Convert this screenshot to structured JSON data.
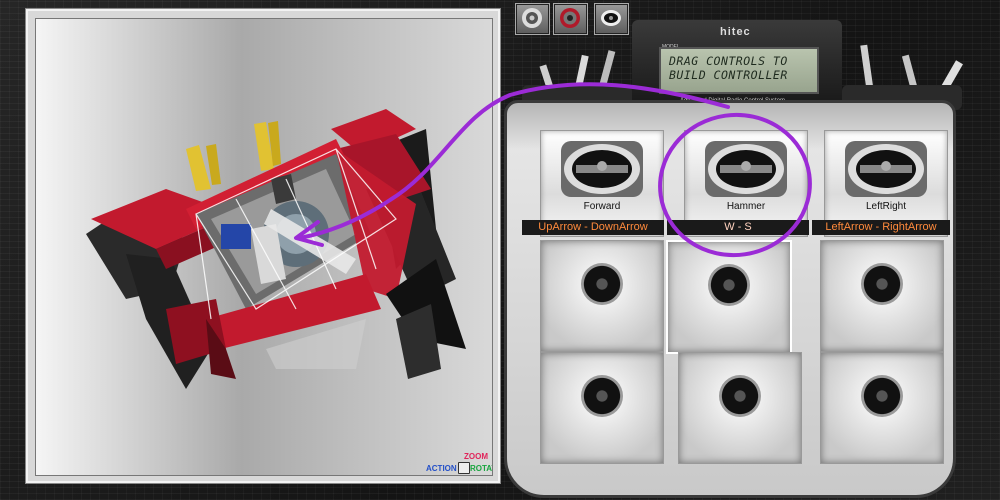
{
  "viewport": {
    "legend": {
      "zoom": "ZOOM",
      "action": "ACTION",
      "rotate": "ROTATE"
    }
  },
  "toolbar": {
    "buttons": [
      {
        "icon": "wheel-icon"
      },
      {
        "icon": "ring-icon"
      },
      {
        "icon": "controller-icon"
      }
    ]
  },
  "transmitter": {
    "brand": "hitec",
    "model": "MODEL",
    "lcd_line1": "DRAG CONTROLS TO",
    "lcd_line2": "BUILD  CONTROLLER",
    "subtitle": "Advanced Digital Radio Control System"
  },
  "channels": [
    {
      "label": "Forward",
      "keys": "UpArrow - DownArrow"
    },
    {
      "label": "Hammer",
      "keys": "W - S"
    },
    {
      "label": "LeftRight",
      "keys": "LeftArrow - RightArrow"
    }
  ],
  "colors": {
    "accent": "#9b2bd6",
    "key_text": "#ff8a3c",
    "robot_red": "#c21a2e"
  }
}
